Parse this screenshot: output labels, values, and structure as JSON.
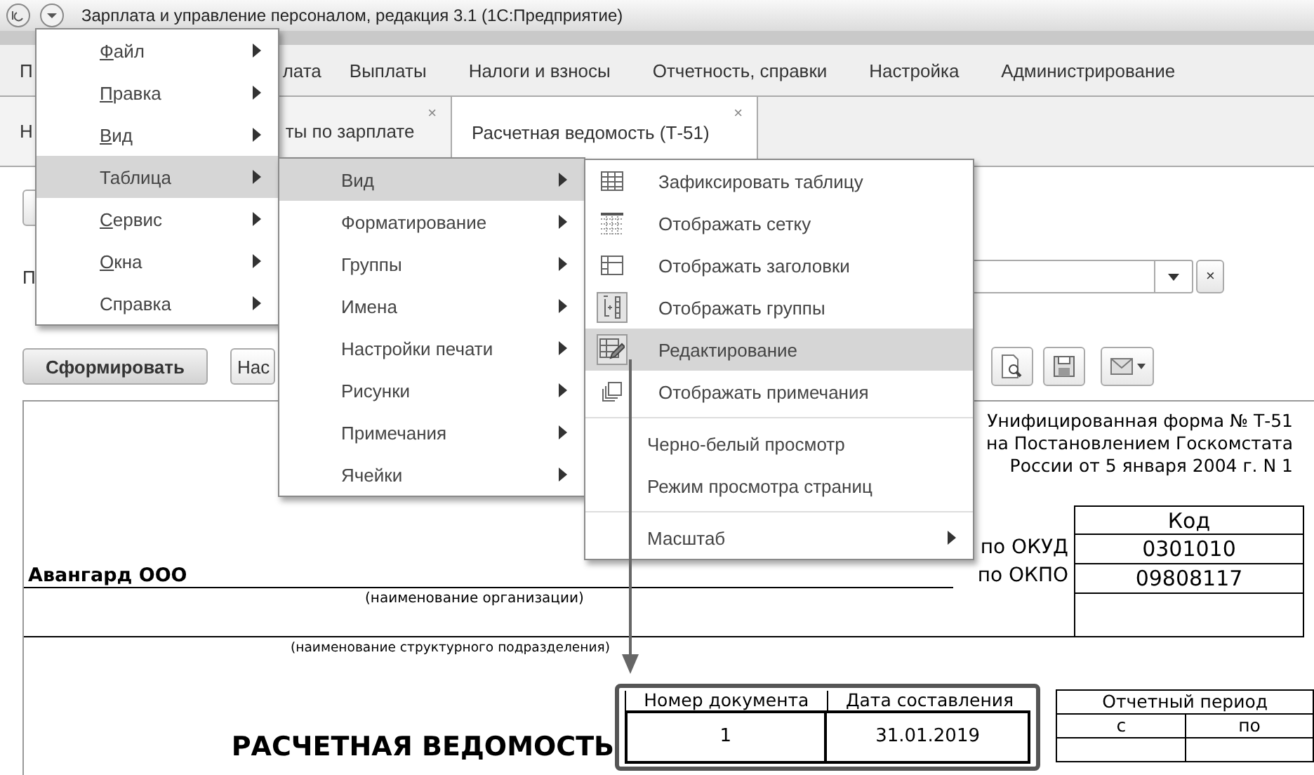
{
  "window": {
    "title": "Зарплата и управление персоналом, редакция 3.1  (1С:Предприятие)"
  },
  "menubar": [
    "П",
    "лата",
    "Выплаты",
    "Налоги и взносы",
    "Отчетность, справки",
    "Настройка",
    "Администрирование"
  ],
  "tabs": [
    {
      "parts": [
        "Н",
        "ты по зарплате"
      ],
      "close": "×",
      "selected": false
    },
    {
      "parts": [
        "Расчетная ведомость (Т-51)"
      ],
      "close": "×",
      "selected": true
    }
  ],
  "form": {
    "field_label": "П",
    "field_clear": "×",
    "generate_button": "Сформировать",
    "settings_button": "Нас"
  },
  "main_menu": [
    {
      "label": "Файл",
      "accel": true,
      "selected": false
    },
    {
      "label": "Правка",
      "accel": true,
      "selected": false
    },
    {
      "label": "Вид",
      "accel": true,
      "selected": false
    },
    {
      "label": "Таблица",
      "accel": false,
      "selected": true
    },
    {
      "label": "Сервис",
      "accel": true,
      "selected": false
    },
    {
      "label": "Окна",
      "accel": true,
      "selected": false
    },
    {
      "label": "Справка",
      "accel": false,
      "selected": false
    }
  ],
  "table_menu": [
    {
      "label": "Вид",
      "selected": true
    },
    {
      "label": "Форматирование",
      "selected": false
    },
    {
      "label": "Группы",
      "selected": false
    },
    {
      "label": "Имена",
      "selected": false
    },
    {
      "label": "Настройки печати",
      "selected": false
    },
    {
      "label": "Рисунки",
      "selected": false
    },
    {
      "label": "Примечания",
      "selected": false
    },
    {
      "label": "Ячейки",
      "selected": false
    }
  ],
  "view_menu": [
    {
      "kind": "icon",
      "label": "Зафиксировать таблицу",
      "checked": false,
      "selected": false
    },
    {
      "kind": "icon",
      "label": "Отображать сетку",
      "checked": false,
      "selected": false
    },
    {
      "kind": "icon",
      "label": "Отображать заголовки",
      "checked": false,
      "selected": false
    },
    {
      "kind": "icon",
      "label": "Отображать группы",
      "checked": true,
      "selected": false
    },
    {
      "kind": "icon",
      "label": "Редактирование",
      "checked": true,
      "selected": true
    },
    {
      "kind": "icon",
      "label": "Отображать примечания",
      "checked": false,
      "selected": false
    },
    {
      "kind": "separator"
    },
    {
      "kind": "plain",
      "label": "Черно-белый просмотр",
      "selected": false
    },
    {
      "kind": "plain",
      "label": "Режим просмотра страниц",
      "selected": false
    },
    {
      "kind": "separator"
    },
    {
      "kind": "submenu",
      "label": "Масштаб",
      "selected": false
    }
  ],
  "report": {
    "form_note": [
      "Унифицированная форма № Т-51",
      "на Постановлением Госкомстата",
      "России от 5 января 2004 г. N 1"
    ],
    "code_header": "Код",
    "codes": [
      {
        "label": "по ОКУД",
        "value": "0301010"
      },
      {
        "label": "по ОКПО",
        "value": "09808117"
      }
    ],
    "organization": "Авангард ООО",
    "organization_caption": "(наименование организации)",
    "department_caption": "(наименование структурного подразделения)",
    "title": "РАСЧЕТНАЯ ВЕДОМОСТЬ",
    "doc_columns": [
      "Номер документа",
      "Дата составления"
    ],
    "doc_values": [
      "1",
      "31.01.2019"
    ],
    "period_header": "Отчетный период",
    "period_columns": [
      "с",
      "по"
    ]
  }
}
